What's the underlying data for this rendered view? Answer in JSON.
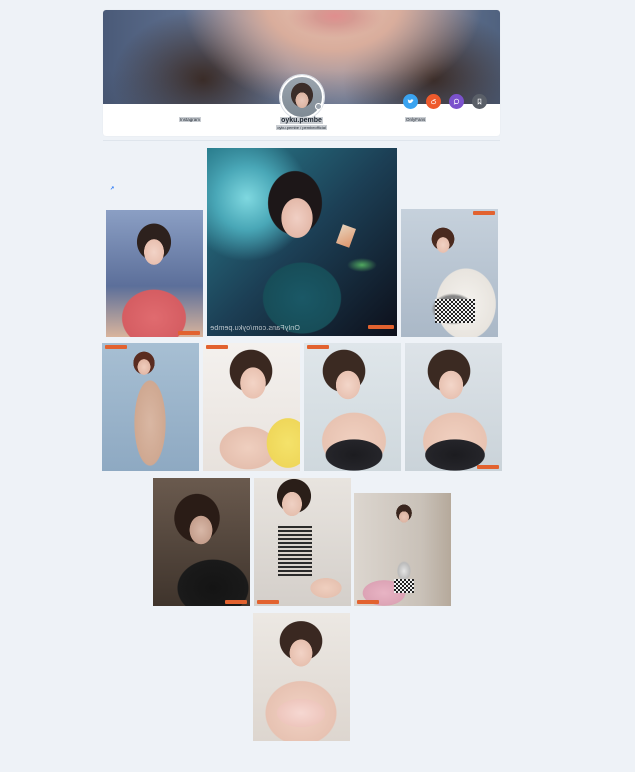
{
  "profile": {
    "username": "oyku.pembe",
    "subtitle": "oyku.pembe / pembeofficial",
    "link_left": "Instagram",
    "link_right": "OnlyFans"
  },
  "social_icons": [
    {
      "name": "twitter-icon",
      "color": "#3aa3f0"
    },
    {
      "name": "reddit-icon",
      "color": "#ee5a2c"
    },
    {
      "name": "chat-icon",
      "color": "#7b52cc"
    },
    {
      "name": "bookmark-icon",
      "color": "#5a5f68"
    }
  ],
  "gallery": {
    "big_caption": "OnlyFans.com/oyku.pembe",
    "watermark_color": "#e2622f"
  },
  "colors": {
    "background": "#eef2f7",
    "card": "#ffffff",
    "link_blue": "#2f7cf6"
  }
}
